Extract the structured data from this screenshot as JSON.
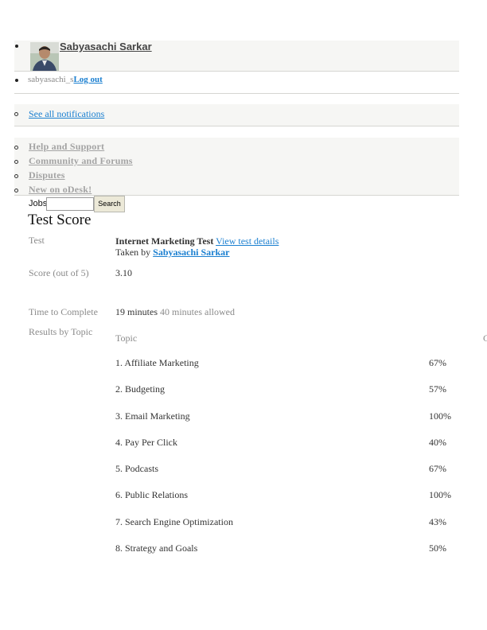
{
  "profile": {
    "name": "Sabyasachi Sarkar",
    "username": "sabyasachi_s",
    "logout_label": "Log out"
  },
  "notifications": {
    "see_all_label": "See all notifications"
  },
  "help_menu": {
    "items": [
      {
        "label": "Help and Support"
      },
      {
        "label": "Community and Forums"
      },
      {
        "label": "Disputes"
      },
      {
        "label": "New on oDesk!"
      }
    ]
  },
  "search": {
    "label": "Jobs",
    "value": "",
    "button_label": "Search"
  },
  "page": {
    "title": "Test Score"
  },
  "test": {
    "label": "Test",
    "name": "Internet Marketing Test",
    "view_details_label": "View test details",
    "taken_by_prefix": "Taken by",
    "taken_by_name": "Sabyasachi Sarkar"
  },
  "score": {
    "label": "Score (out of 5)",
    "value": "3.10"
  },
  "time": {
    "label": "Time to Complete",
    "taken": "19 minutes",
    "allowed": "40 minutes allowed"
  },
  "results": {
    "label": "Results by Topic",
    "columns": [
      "Topic",
      "C"
    ],
    "rows": [
      {
        "topic": "1. Affiliate Marketing",
        "percent": "67%"
      },
      {
        "topic": "2. Budgeting",
        "percent": "57%"
      },
      {
        "topic": "3. Email Marketing",
        "percent": "100%"
      },
      {
        "topic": "4. Pay Per Click",
        "percent": "40%"
      },
      {
        "topic": "5. Podcasts",
        "percent": "67%"
      },
      {
        "topic": "6. Public Relations",
        "percent": "100%"
      },
      {
        "topic": "7. Search Engine Optimization",
        "percent": "43%"
      },
      {
        "topic": "8. Strategy and Goals",
        "percent": "50%"
      }
    ]
  },
  "colors": {
    "link": "#1a7fd0",
    "muted": "#8a8a8a",
    "band": "#f6f6f4"
  }
}
